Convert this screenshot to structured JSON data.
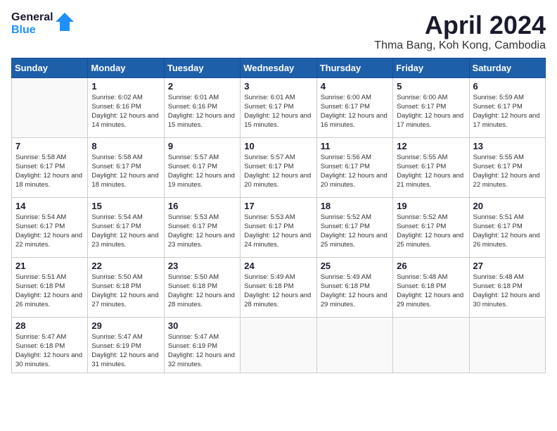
{
  "header": {
    "logo_general": "General",
    "logo_blue": "Blue",
    "month_title": "April 2024",
    "location": "Thma Bang, Koh Kong, Cambodia"
  },
  "weekdays": [
    "Sunday",
    "Monday",
    "Tuesday",
    "Wednesday",
    "Thursday",
    "Friday",
    "Saturday"
  ],
  "weeks": [
    [
      {
        "day": null
      },
      {
        "day": 1,
        "sunrise": "6:02 AM",
        "sunset": "6:16 PM",
        "daylight": "12 hours and 14 minutes."
      },
      {
        "day": 2,
        "sunrise": "6:01 AM",
        "sunset": "6:16 PM",
        "daylight": "12 hours and 15 minutes."
      },
      {
        "day": 3,
        "sunrise": "6:01 AM",
        "sunset": "6:17 PM",
        "daylight": "12 hours and 15 minutes."
      },
      {
        "day": 4,
        "sunrise": "6:00 AM",
        "sunset": "6:17 PM",
        "daylight": "12 hours and 16 minutes."
      },
      {
        "day": 5,
        "sunrise": "6:00 AM",
        "sunset": "6:17 PM",
        "daylight": "12 hours and 17 minutes."
      },
      {
        "day": 6,
        "sunrise": "5:59 AM",
        "sunset": "6:17 PM",
        "daylight": "12 hours and 17 minutes."
      }
    ],
    [
      {
        "day": 7,
        "sunrise": "5:58 AM",
        "sunset": "6:17 PM",
        "daylight": "12 hours and 18 minutes."
      },
      {
        "day": 8,
        "sunrise": "5:58 AM",
        "sunset": "6:17 PM",
        "daylight": "12 hours and 18 minutes."
      },
      {
        "day": 9,
        "sunrise": "5:57 AM",
        "sunset": "6:17 PM",
        "daylight": "12 hours and 19 minutes."
      },
      {
        "day": 10,
        "sunrise": "5:57 AM",
        "sunset": "6:17 PM",
        "daylight": "12 hours and 20 minutes."
      },
      {
        "day": 11,
        "sunrise": "5:56 AM",
        "sunset": "6:17 PM",
        "daylight": "12 hours and 20 minutes."
      },
      {
        "day": 12,
        "sunrise": "5:55 AM",
        "sunset": "6:17 PM",
        "daylight": "12 hours and 21 minutes."
      },
      {
        "day": 13,
        "sunrise": "5:55 AM",
        "sunset": "6:17 PM",
        "daylight": "12 hours and 22 minutes."
      }
    ],
    [
      {
        "day": 14,
        "sunrise": "5:54 AM",
        "sunset": "6:17 PM",
        "daylight": "12 hours and 22 minutes."
      },
      {
        "day": 15,
        "sunrise": "5:54 AM",
        "sunset": "6:17 PM",
        "daylight": "12 hours and 23 minutes."
      },
      {
        "day": 16,
        "sunrise": "5:53 AM",
        "sunset": "6:17 PM",
        "daylight": "12 hours and 23 minutes."
      },
      {
        "day": 17,
        "sunrise": "5:53 AM",
        "sunset": "6:17 PM",
        "daylight": "12 hours and 24 minutes."
      },
      {
        "day": 18,
        "sunrise": "5:52 AM",
        "sunset": "6:17 PM",
        "daylight": "12 hours and 25 minutes."
      },
      {
        "day": 19,
        "sunrise": "5:52 AM",
        "sunset": "6:17 PM",
        "daylight": "12 hours and 25 minutes."
      },
      {
        "day": 20,
        "sunrise": "5:51 AM",
        "sunset": "6:17 PM",
        "daylight": "12 hours and 26 minutes."
      }
    ],
    [
      {
        "day": 21,
        "sunrise": "5:51 AM",
        "sunset": "6:18 PM",
        "daylight": "12 hours and 26 minutes."
      },
      {
        "day": 22,
        "sunrise": "5:50 AM",
        "sunset": "6:18 PM",
        "daylight": "12 hours and 27 minutes."
      },
      {
        "day": 23,
        "sunrise": "5:50 AM",
        "sunset": "6:18 PM",
        "daylight": "12 hours and 28 minutes."
      },
      {
        "day": 24,
        "sunrise": "5:49 AM",
        "sunset": "6:18 PM",
        "daylight": "12 hours and 28 minutes."
      },
      {
        "day": 25,
        "sunrise": "5:49 AM",
        "sunset": "6:18 PM",
        "daylight": "12 hours and 29 minutes."
      },
      {
        "day": 26,
        "sunrise": "5:48 AM",
        "sunset": "6:18 PM",
        "daylight": "12 hours and 29 minutes."
      },
      {
        "day": 27,
        "sunrise": "5:48 AM",
        "sunset": "6:18 PM",
        "daylight": "12 hours and 30 minutes."
      }
    ],
    [
      {
        "day": 28,
        "sunrise": "5:47 AM",
        "sunset": "6:18 PM",
        "daylight": "12 hours and 30 minutes."
      },
      {
        "day": 29,
        "sunrise": "5:47 AM",
        "sunset": "6:19 PM",
        "daylight": "12 hours and 31 minutes."
      },
      {
        "day": 30,
        "sunrise": "5:47 AM",
        "sunset": "6:19 PM",
        "daylight": "12 hours and 32 minutes."
      },
      {
        "day": null
      },
      {
        "day": null
      },
      {
        "day": null
      },
      {
        "day": null
      }
    ]
  ]
}
